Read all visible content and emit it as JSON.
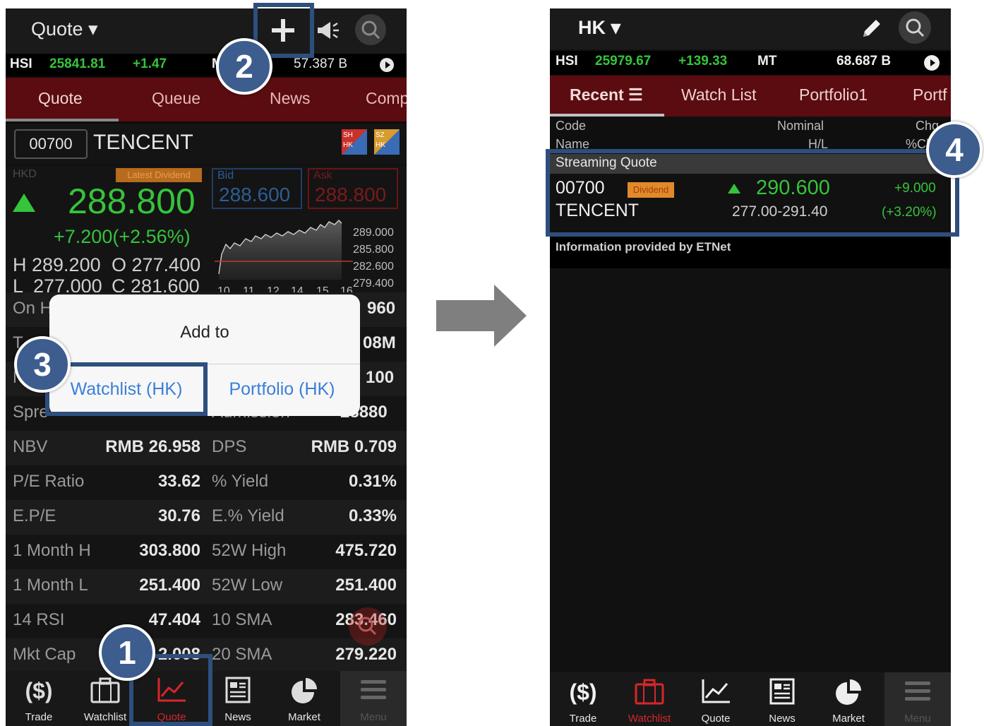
{
  "left": {
    "header": {
      "title": "Quote ▾"
    },
    "ticker": {
      "name": "HSI",
      "value": "25841.81",
      "change": "+1.47",
      "mt": "M",
      "turnover": "57.387 B"
    },
    "tabs": [
      "Quote",
      "Queue",
      "News",
      "Comp"
    ],
    "stock": {
      "code": "00700",
      "name": "TENCENT",
      "badge1": "SH HK",
      "badge2": "SZ HK"
    },
    "price": {
      "currency": "HKD",
      "latest_dividend": "Latest Dividend",
      "last": "288.800",
      "change": "+7.200(+2.56%)",
      "bid_label": "Bid",
      "bid": "288.600",
      "ask_label": "Ask",
      "ask": "288.800",
      "high": "H 289.200",
      "open": "O 277.400",
      "low": "L  277.000",
      "close": "C 281.600"
    },
    "chart_axis": {
      "y": [
        "289.000",
        "285.800",
        "282.600",
        "279.400"
      ],
      "x": [
        "10",
        "11",
        "12",
        "14",
        "15",
        "16"
      ]
    },
    "partial_rows": [
      {
        "label": "On H",
        "value": "960"
      },
      {
        "label": "T",
        "value": "08M"
      },
      {
        "label": "N",
        "value": "100"
      },
      {
        "label": "Spre",
        "mid": "Admission",
        "value": "28880"
      }
    ],
    "rows": [
      {
        "l1": "NBV",
        "v1": "RMB 26.958",
        "l2": "DPS",
        "v2": "RMB 0.709"
      },
      {
        "l1": "P/E Ratio",
        "v1": "33.62",
        "l2": "% Yield",
        "v2": "0.31%"
      },
      {
        "l1": "E.P/E",
        "v1": "30.76",
        "l2": "E.% Yield",
        "v2": "0.33%"
      },
      {
        "l1": "1 Month H",
        "v1": "303.800",
        "l2": "52W High",
        "v2": "475.720"
      },
      {
        "l1": "1 Month L",
        "v1": "251.400",
        "l2": "52W Low",
        "v2": "251.400"
      },
      {
        "l1": "14 RSI",
        "v1": "47.404",
        "l2": "10 SMA",
        "v2": "283.460"
      },
      {
        "l1": "Mkt Cap",
        "v1": "2.008",
        "l2": "20 SMA",
        "v2": "279.220"
      }
    ],
    "dialog": {
      "title": "Add to",
      "option1": "Watchlist (HK)",
      "option2": "Portfolio (HK)"
    },
    "nav": [
      "Trade",
      "Watchlist",
      "Quote",
      "News",
      "Market",
      "Menu"
    ]
  },
  "right": {
    "header": {
      "title": "HK ▾"
    },
    "ticker": {
      "name": "HSI",
      "value": "25979.67",
      "change": "+139.33",
      "mt": "MT",
      "turnover": "68.687 B"
    },
    "tabs": [
      "Recent ☰",
      "Watch List",
      "Portfolio1",
      "Portf"
    ],
    "columns": {
      "code": "Code",
      "name": "Name",
      "nominal": "Nominal",
      "hl": "H/L",
      "chg": "Chg",
      "pchg": "%Ch"
    },
    "section": "Streaming Quote",
    "item": {
      "code": "00700",
      "dividend": "Dividend",
      "price": "290.600",
      "change": "+9.000",
      "name": "TENCENT",
      "range": "277.00-291.40",
      "pchange": "(+3.20%)"
    },
    "info": "Information provided by ETNet",
    "nav": [
      "Trade",
      "Watchlist",
      "Quote",
      "News",
      "Market",
      "Menu"
    ]
  },
  "badges": [
    "1",
    "2",
    "3",
    "4"
  ],
  "colors": {
    "green": "#35c43b",
    "red": "#e0262b",
    "tab_bg": "#5a0c10",
    "callout": "#2e4f7d",
    "badge": "#3d5d8e"
  }
}
